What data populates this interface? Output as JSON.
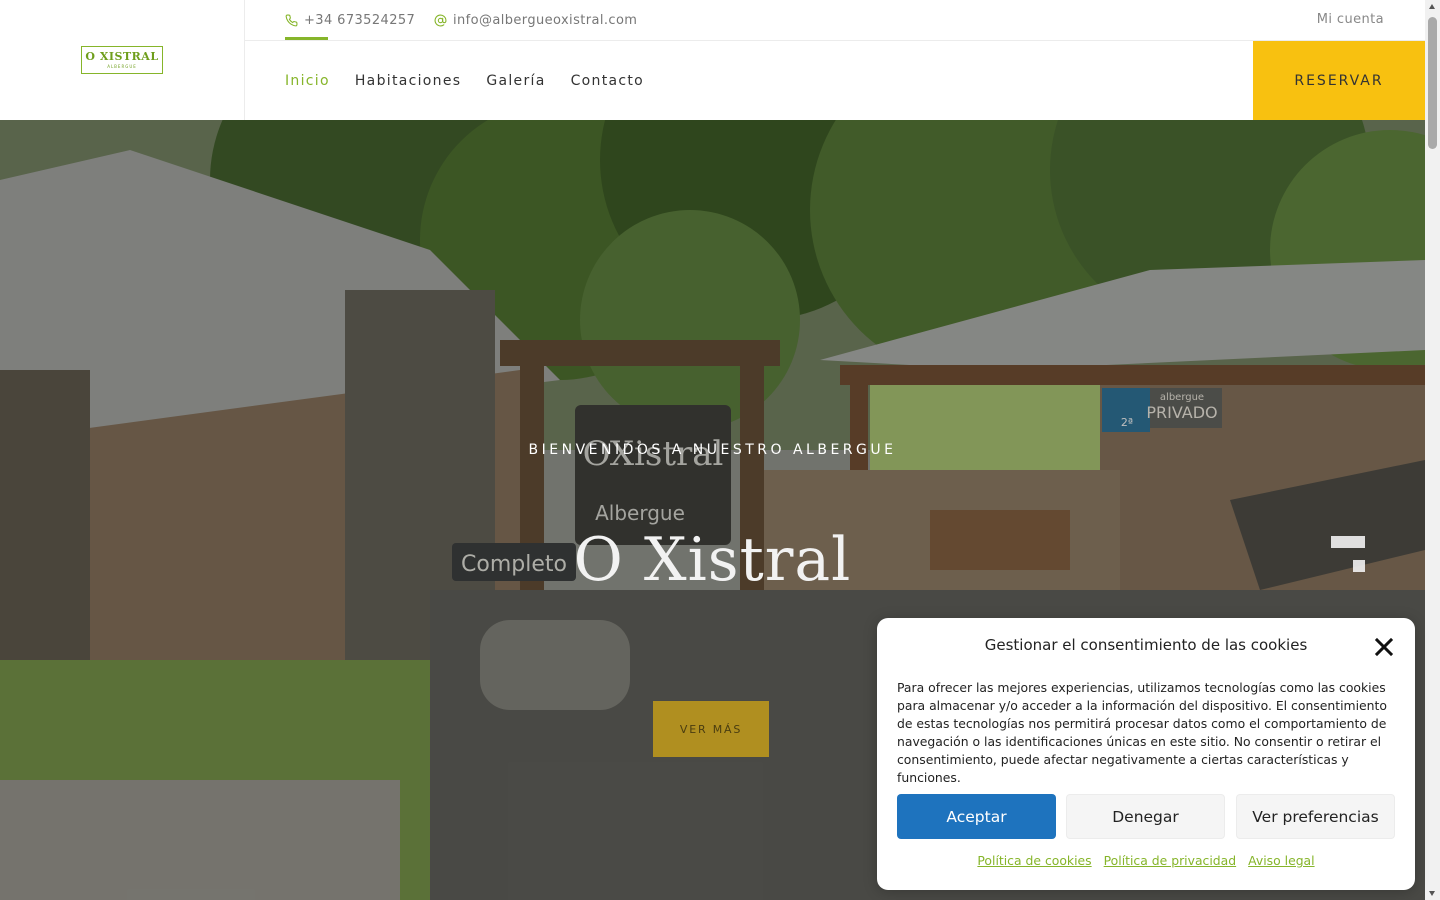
{
  "header": {
    "logo": {
      "title": "O XISTRAL",
      "subtitle": "ALBERGUE"
    },
    "topbar": {
      "phone": "+34 673524257",
      "email": "info@albergueoxistral.com",
      "account": "Mi cuenta"
    },
    "nav": [
      {
        "label": "Inicio",
        "active": true
      },
      {
        "label": "Habitaciones",
        "active": false
      },
      {
        "label": "Galería",
        "active": false
      },
      {
        "label": "Contacto",
        "active": false
      }
    ],
    "reserve_label": "RESERVAR"
  },
  "hero": {
    "subtitle": "BIENVENIDOS A NUESTRO ALBERGUE",
    "title": "O Xistral",
    "cta_label": "VER MÁS",
    "photo_signs": {
      "sign_main": "OXistral",
      "sign_sub": "Albergue",
      "sign_full": "Completo",
      "sign_private_top": "albergue",
      "sign_private": "PRIVADO",
      "sign_num": "2ª"
    }
  },
  "cookie_dialog": {
    "title": "Gestionar el consentimiento de las cookies",
    "text": "Para ofrecer las mejores experiencias, utilizamos tecnologías como las cookies para almacenar y/o acceder a la información del dispositivo. El consentimiento de estas tecnologías nos permitirá procesar datos como el comportamiento de navegación o las identificaciones únicas en este sitio. No consentir o retirar el consentimiento, puede afectar negativamente a ciertas características y funciones.",
    "buttons": {
      "accept": "Aceptar",
      "deny": "Denegar",
      "preferences": "Ver preferencias"
    },
    "links": {
      "cookies": "Política de cookies",
      "privacy": "Política de privacidad",
      "legal": "Aviso legal"
    }
  },
  "colors": {
    "accent_green": "#86b52a",
    "accent_yellow": "#f8c110",
    "button_blue": "#1e73be"
  },
  "icons": {
    "phone": "phone-icon",
    "email": "at-sign-icon",
    "close": "close-icon"
  }
}
